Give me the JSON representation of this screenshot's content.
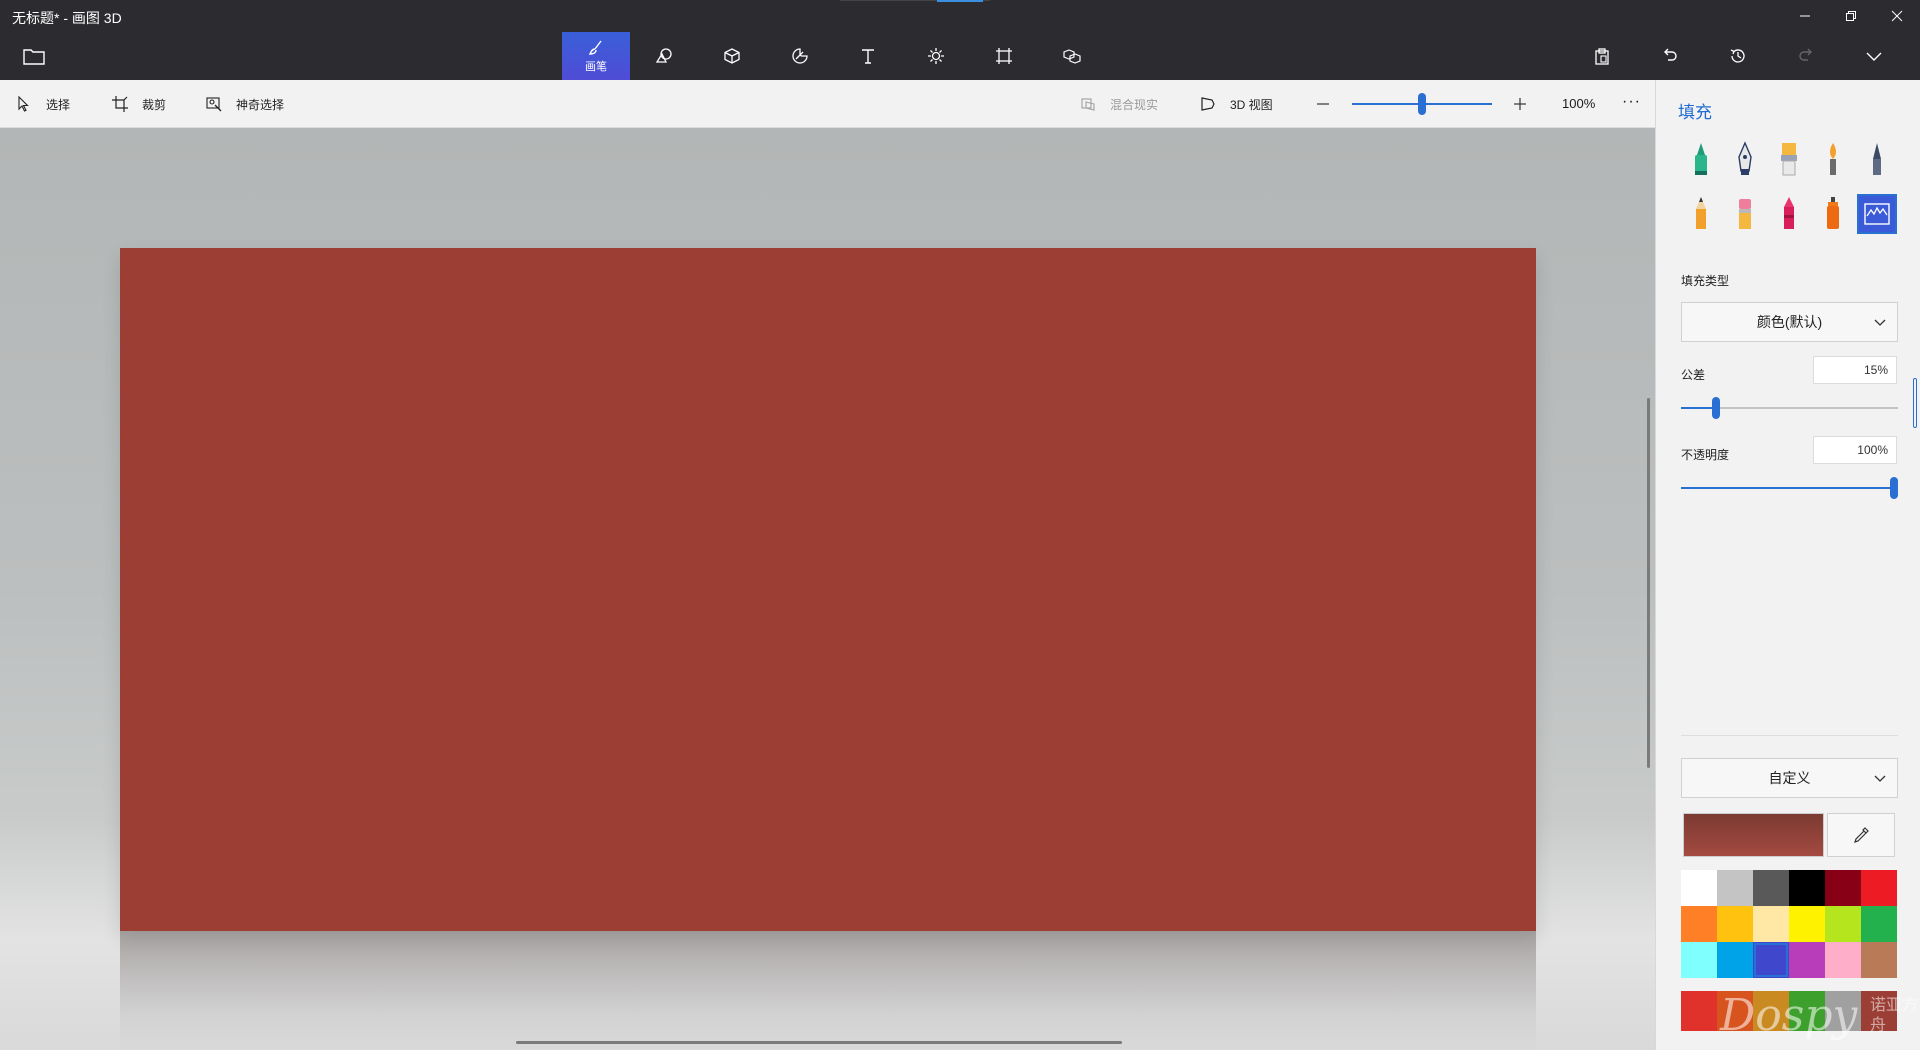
{
  "window": {
    "title": "无标题* - 画图 3D"
  },
  "ribbon": {
    "active_tool_label": "画笔",
    "tools": [
      "brush-icon",
      "2d-shapes-icon",
      "3d-shapes-icon",
      "stickers-icon",
      "text-icon",
      "effects-icon",
      "canvas-icon",
      "3d-library-icon"
    ]
  },
  "toolbar": {
    "select_label": "选择",
    "crop_label": "裁剪",
    "magic_select_label": "神奇选择",
    "mixed_reality_label": "混合现实",
    "view3d_label": "3D 视图",
    "zoom_value": "100%",
    "zoom_fraction": 0.5
  },
  "canvas": {
    "color": "#9c3e34"
  },
  "panel": {
    "title": "填充",
    "fill_type_label": "填充类型",
    "fill_type_value": "颜色(默认)",
    "tolerance_label": "公差",
    "tolerance_value": "15%",
    "tolerance_fraction": 0.15,
    "opacity_label": "不透明度",
    "opacity_value": "100%",
    "opacity_fraction": 1.0,
    "color_source_value": "自定义",
    "current_color": "#9c3e34",
    "palette": [
      "#ffffff",
      "#c4c4c4",
      "#595959",
      "#000000",
      "#880015",
      "#ed1c24",
      "#ff7f27",
      "#ffc20e",
      "#ffe8a5",
      "#fff200",
      "#b5e61d",
      "#22b14c",
      "#80ffff",
      "#00a2e8",
      "#3f48cc",
      "#b83dba",
      "#ffaec9",
      "#b97a57"
    ],
    "palette_row2": [
      "#e0312a",
      "#d7541e",
      "#c98a22",
      "#3da02c",
      "#a0a0a0",
      "#9b3e35"
    ]
  },
  "watermark": {
    "text": "Dospy",
    "small": "诺亚方舟"
  }
}
